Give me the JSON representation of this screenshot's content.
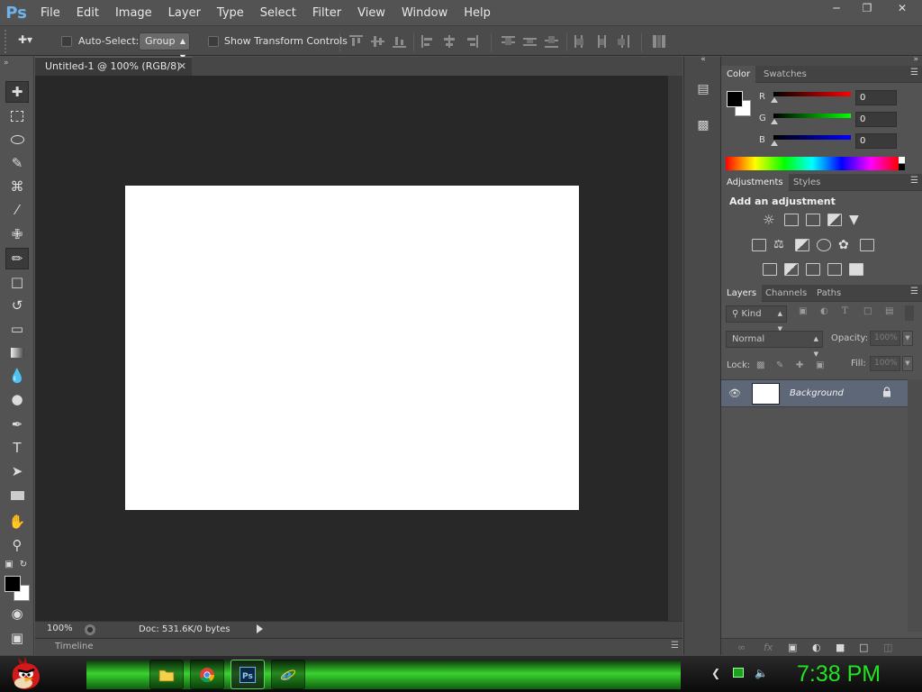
{
  "app": {
    "logo_text": "Ps"
  },
  "menubar": {
    "items": [
      "File",
      "Edit",
      "Image",
      "Layer",
      "Type",
      "Select",
      "Filter",
      "View",
      "Window",
      "Help"
    ]
  },
  "options": {
    "auto_select_label": "Auto-Select:",
    "auto_select_value": "Group",
    "show_transform_label": "Show Transform Controls",
    "auto_select_checked": false,
    "show_transform_checked": false
  },
  "document": {
    "tab_title": "Untitled-1 @ 100% (RGB/8)",
    "zoom": "100%",
    "doc_info": "Doc: 531.6K/0 bytes",
    "timeline_label": "Timeline"
  },
  "color_panel": {
    "tabs": [
      "Color",
      "Swatches"
    ],
    "channels": [
      {
        "label": "R",
        "value": "0",
        "color": "#cc0000"
      },
      {
        "label": "G",
        "value": "0",
        "color": "#00b300"
      },
      {
        "label": "B",
        "value": "0",
        "color": "#0000cc"
      }
    ],
    "foreground": "#000000",
    "background": "#ffffff"
  },
  "adjustments_panel": {
    "tabs": [
      "Adjustments",
      "Styles"
    ],
    "title": "Add an adjustment"
  },
  "layers_panel": {
    "tabs": [
      "Layers",
      "Channels",
      "Paths"
    ],
    "filter_kind": "Kind",
    "blend_mode": "Normal",
    "opacity_label": "Opacity:",
    "opacity_value": "100%",
    "lock_label": "Lock:",
    "fill_label": "Fill:",
    "fill_value": "100%",
    "layers": [
      {
        "name": "Background",
        "visible": true,
        "locked": true
      }
    ]
  },
  "taskbar": {
    "clock": "7:38 PM"
  }
}
